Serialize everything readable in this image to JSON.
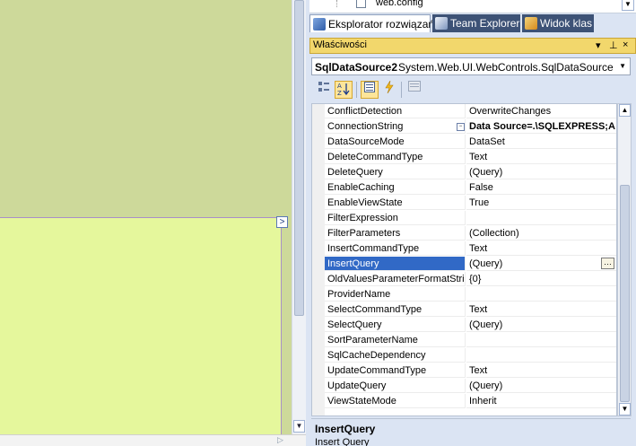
{
  "solution_explorer": {
    "visible_file": "web.config"
  },
  "tabs": [
    {
      "label": "Eksplorator rozwiązań",
      "active": true
    },
    {
      "label": "Team Explorer",
      "active": false
    },
    {
      "label": "Widok klas",
      "active": false
    }
  ],
  "properties_panel": {
    "title": "Właściwości",
    "header_buttons": {
      "dropdown": "▾",
      "pin": "⊥",
      "close": "×"
    },
    "object_name": "SqlDataSource2",
    "object_type": "System.Web.UI.WebControls.SqlDataSource",
    "selected_property": "InsertQuery",
    "rows": [
      {
        "name": "ConflictDetection",
        "value": "OverwriteChanges"
      },
      {
        "name": "ConnectionString",
        "value": "Data Source=.\\SQLEXPRESS;A",
        "bold": true,
        "expandable": true
      },
      {
        "name": "DataSourceMode",
        "value": "DataSet"
      },
      {
        "name": "DeleteCommandType",
        "value": "Text"
      },
      {
        "name": "DeleteQuery",
        "value": "(Query)"
      },
      {
        "name": "EnableCaching",
        "value": "False"
      },
      {
        "name": "EnableViewState",
        "value": "True"
      },
      {
        "name": "FilterExpression",
        "value": ""
      },
      {
        "name": "FilterParameters",
        "value": "(Collection)"
      },
      {
        "name": "InsertCommandType",
        "value": "Text"
      },
      {
        "name": "InsertQuery",
        "value": "(Query)",
        "selected": true,
        "has_ellipsis": true
      },
      {
        "name": "OldValuesParameterFormatString",
        "value": "{0}"
      },
      {
        "name": "ProviderName",
        "value": ""
      },
      {
        "name": "SelectCommandType",
        "value": "Text"
      },
      {
        "name": "SelectQuery",
        "value": "(Query)"
      },
      {
        "name": "SortParameterName",
        "value": ""
      },
      {
        "name": "SqlCacheDependency",
        "value": ""
      },
      {
        "name": "UpdateCommandType",
        "value": "Text"
      },
      {
        "name": "UpdateQuery",
        "value": "(Query)"
      },
      {
        "name": "ViewStateMode",
        "value": "Inherit"
      }
    ],
    "description": {
      "title": "InsertQuery",
      "text": "Insert Query"
    }
  },
  "colors": {
    "designer_top": "#cdd99a",
    "designer_bottom": "#e5f79c",
    "panel_background": "#dbe4f3",
    "header_gold": "#f2d76c",
    "selection_blue": "#3169c6",
    "tab_dark": "#3d5276"
  }
}
